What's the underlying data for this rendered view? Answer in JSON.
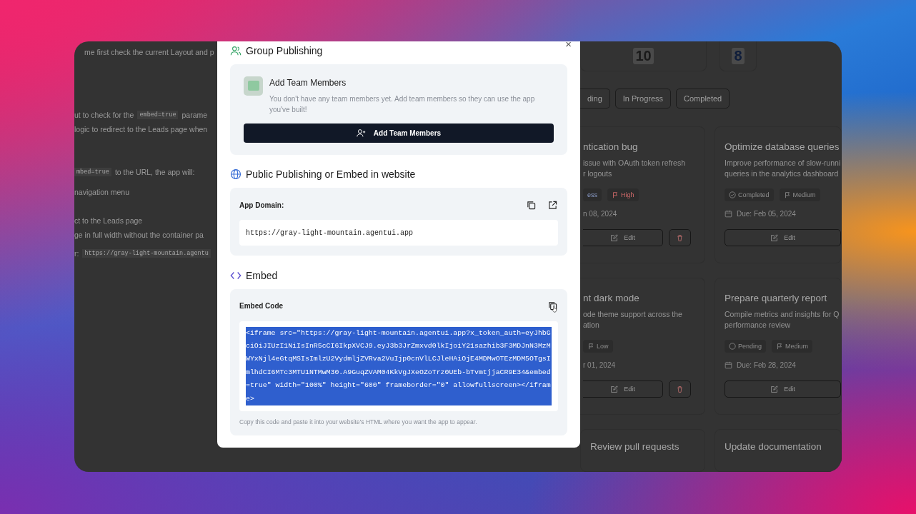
{
  "background_chat": {
    "lines": [
      [
        {
          "kind": "text",
          "text": "me first check the current Layout and p"
        }
      ],
      [
        {
          "kind": "text",
          "text": "ut to check for the"
        },
        {
          "kind": "code",
          "text": "embed=true"
        },
        {
          "kind": "text",
          "text": "parame"
        }
      ],
      [
        {
          "kind": "text",
          "text": "logic to redirect to the Leads page when"
        }
      ],
      [
        {
          "kind": "code",
          "text": "mbed=true"
        },
        {
          "kind": "text",
          "text": "to the URL, the app will:"
        }
      ],
      [
        {
          "kind": "text",
          "text": "navigation menu"
        }
      ],
      [
        {
          "kind": "text",
          "text": "ct to the Leads page"
        }
      ],
      [
        {
          "kind": "text",
          "text": "ge in full width without the container pa"
        }
      ],
      [
        {
          "kind": "text",
          "text": "r:"
        },
        {
          "kind": "code",
          "text": "https://gray-light-mountain.agentu"
        }
      ]
    ]
  },
  "background_board": {
    "stats": [
      {
        "value": "10",
        "color": "#1a1a1a"
      },
      {
        "value": "8",
        "color": "#0f1d3a"
      }
    ],
    "filters": [
      {
        "label": "ding"
      },
      {
        "label": "In Progress"
      },
      {
        "label": "Completed"
      }
    ],
    "cards": [
      {
        "cut": true,
        "title": "ntication bug",
        "description": [
          "issue with OAuth token refresh",
          "r logouts"
        ],
        "status": {
          "kind": "in_progress",
          "label": "ess"
        },
        "priority": {
          "kind": "high",
          "label": "High"
        },
        "due": "n 08, 2024",
        "edit": "Edit",
        "deletable": true
      },
      {
        "cut": false,
        "title": "Optimize database queries",
        "description": [
          "Improve performance of slow-runni",
          "queries in the analytics dashboard"
        ],
        "status": {
          "kind": "completed",
          "label": "Completed"
        },
        "priority": {
          "kind": "medium",
          "label": "Medium"
        },
        "due": "Due: Feb 05, 2024",
        "edit": "Edit",
        "deletable": false
      },
      {
        "cut": true,
        "title": "nt dark mode",
        "description": [
          "ode theme support across the",
          "ation"
        ],
        "priority": {
          "kind": "low",
          "label": "Low"
        },
        "due": "r 01, 2024",
        "edit": "Edit",
        "deletable": true
      },
      {
        "cut": false,
        "title": "Prepare quarterly report",
        "description": [
          "Compile metrics and insights for Q",
          "performance review"
        ],
        "status": {
          "kind": "pending",
          "label": "Pending"
        },
        "priority": {
          "kind": "medium",
          "label": "Medium"
        },
        "due": "Due: Feb 28, 2024",
        "edit": "Edit",
        "deletable": false
      },
      {
        "cut": false,
        "title": "Review pull requests"
      },
      {
        "cut": false,
        "title": "Update documentation"
      }
    ]
  },
  "modal": {
    "close": "×",
    "group_publishing": {
      "title": "Group Publishing",
      "card_title": "Add Team Members",
      "card_text": "You don't have any team members yet. Add team members so they can use the app you've built!",
      "button": "Add Team Members"
    },
    "public_publishing": {
      "title": "Public Publishing or Embed in website",
      "domain_label": "App Domain:",
      "domain": "https://gray-light-mountain.agentui.app"
    },
    "embed": {
      "title": "Embed",
      "label": "Embed Code",
      "code": "<iframe src=\"https://gray-light-mountain.agentui.app?x_token_auth=eyJhbGciOiJIUzI1NiIsInR5cCI6IkpXVCJ9.eyJ3b3JrZmxvd0lkIjoiY21sazhib3F3MDJnN3MzMWYxNjl4eGtqMSIsImlzU2VydmljZVRva2VuIjp0cnVlLCJleHAiOjE4MDMwOTEzMDM5OTgsImlhdCI6MTc3MTU1NTMwM30.A9GuqZVAM04KkVgJXeOZoTrz0UEb-bTvmtjjaCR9E34&embed=true\" width=\"100%\" height=\"600\" frameborder=\"0\" allowfullscreen></iframe>",
      "code_selected": true,
      "hint": "Copy this code and paste it into your website's HTML where you want the app to appear."
    }
  }
}
